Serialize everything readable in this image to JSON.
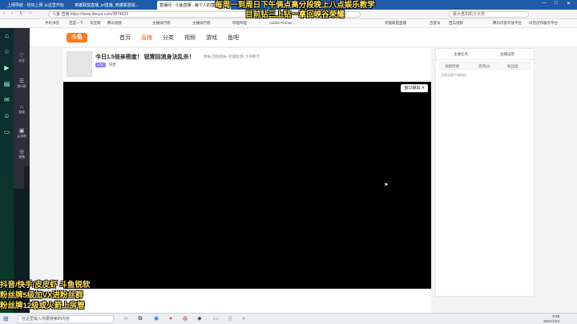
{
  "browser": {
    "tabs": [
      {
        "label": "上网导航 - 轻快上网 从这里开始"
      },
      {
        "label": "英雄联盟直播_lol直播_英雄联盟视..."
      },
      {
        "label": "直播间 - 斗鱼直播 - 每个人的直播平台"
      }
    ],
    "url": "斗鱼 直播 https://www.douyu.com/3874829",
    "search_placeholder": "最大盘扣机分大突",
    "bookmarks": [
      "手机书签",
      "百度一下",
      "淘宝网",
      "腾讯视频",
      "主播排行榜",
      "主播排行榜",
      "哔哩哔哩",
      "Adobe Premie...",
      "英雄联盟直播",
      "百度号",
      "西瓜视频",
      "腾讯内容开放平台",
      "抖音创作服务平台"
    ]
  },
  "app_sidebar": {
    "icons": [
      "home-icon",
      "star-icon",
      "film-icon",
      "book-icon",
      "mail-icon",
      "wechat-icon",
      "folder-icon"
    ]
  },
  "douyu_nav": [
    {
      "icon": "♡",
      "label": "关注"
    },
    {
      "icon": "☰",
      "label": "排行榜"
    },
    {
      "icon": "⌂",
      "label": "游戏"
    },
    {
      "icon": "▣",
      "label": "云游戏"
    },
    {
      "icon": "◎",
      "label": "直播"
    }
  ],
  "site": {
    "logo": "斗鱼",
    "nav": [
      "首页",
      "直播",
      "分类",
      "视频",
      "游戏",
      "鱼吧"
    ],
    "active_nav": "直播"
  },
  "room": {
    "title": "今日1.5倍亲密度！ 锐雯回流身法乱杀！",
    "meta": "举报  回放相关•  英雄联盟•  大神教学",
    "tag": "LOL",
    "tag_text": "锐雯"
  },
  "player": {
    "popout_label": "窗口弹出 ✕"
  },
  "right_panel": {
    "tabs_top": [
      "主播任务",
      "直播运营"
    ],
    "tabs_second": [
      "贡献周榜",
      "贵宾(0)",
      "粉丝团"
    ],
    "note": "消息加载中请稍候"
  },
  "overlay": {
    "top_lines": [
      "每周一到周日下午俩点高分段晚上八点娱乐教学",
      "目前钻三上钻一拿回峡谷荣耀"
    ],
    "bottom_lines": [
      "抖音/快手/皮皮虾 斗鱼锐软",
      "粉丝牌5级加VX进粉丝群",
      "粉丝牌12级或火箭上房管"
    ],
    "small_id": "3874829"
  },
  "taskbar": {
    "search_placeholder": "在这里输入你要搜索的内容",
    "time": "9:39",
    "date": "2021/1/23"
  }
}
